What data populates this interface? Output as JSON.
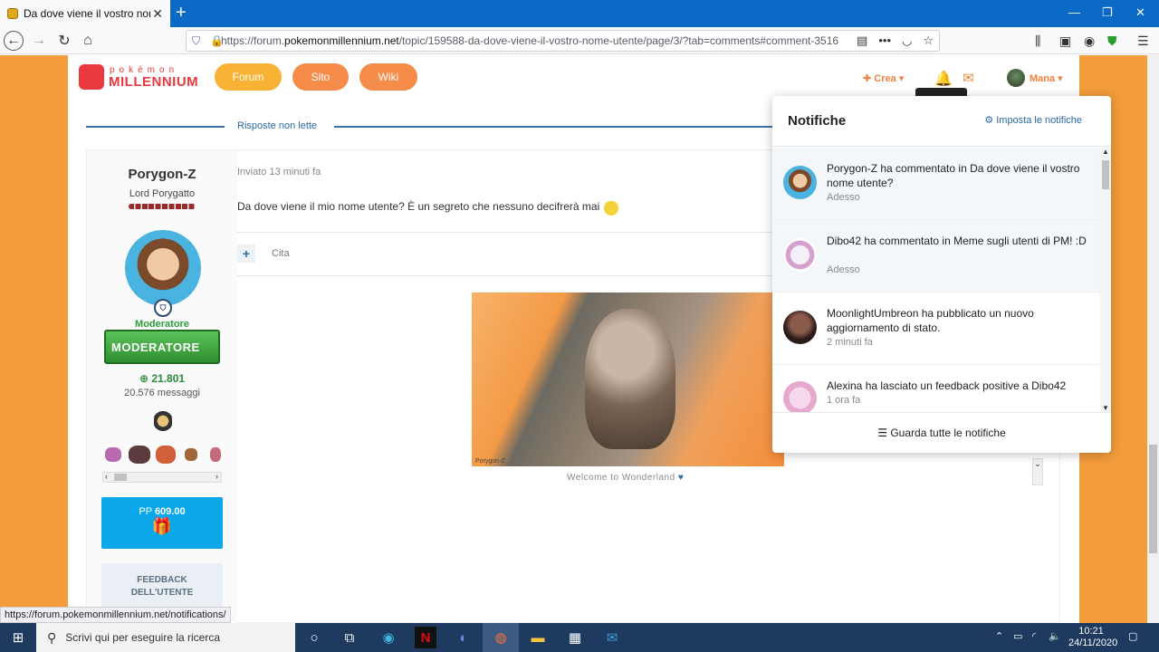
{
  "browser": {
    "tab_title": "Da dove viene il vostro nome u",
    "url_prefix": "https://forum.",
    "url_domain": "pokemonmillennium.net",
    "url_path": "/topic/159588-da-dove-viene-il-vostro-nome-utente/page/3/?tab=comments#comment-3516",
    "status_url": "https://forum.pokemonmillennium.net/notifications/"
  },
  "site": {
    "logo_small": "pokémon",
    "logo_big": "MILLENNIUM",
    "nav": [
      "Forum",
      "Sito",
      "Wiki"
    ],
    "nav_colors": [
      "#f9b233",
      "#f58c4a",
      "#f58c4a"
    ],
    "crea_label": "Crea",
    "user_name": "Mana"
  },
  "thread": {
    "unread_label": "Risposte non lette"
  },
  "post": {
    "author": "Porygon-Z",
    "author_title": "Lord Porygatto",
    "role": "Moderatore",
    "badge_text": "MODERATORE",
    "reputation": "21.801",
    "messages": "20.576 messaggi",
    "pp_label": "PP",
    "pp_value": "609.00",
    "feedback_label_1": "FEEDBACK",
    "feedback_label_2": "DELL'UTENTE",
    "posted": "Inviato 13 minuti fa",
    "text": "Da dove viene il mio nome utente? È un segreto che nessuno decifrerà mai",
    "quote_label": "Cita",
    "signature_caption": "Welcome to Wonderland",
    "signature_watermark": "Porygon-Z"
  },
  "notifications": {
    "title": "Notifiche",
    "settings_label": "Imposta le notifiche",
    "footer_label": "Guarda tutte le notifiche",
    "items": [
      {
        "text": "Porygon-Z ha commentato in Da dove viene il vostro nome utente?",
        "time": "Adesso",
        "unread": true
      },
      {
        "text": "Dibo42 ha commentato in Meme sugli utenti di PM! :D",
        "time": "Adesso",
        "unread": true
      },
      {
        "text": "MoonlightUmbreon ha pubblicato un nuovo aggiornamento di stato.",
        "time": "2 minuti fa",
        "unread": false
      },
      {
        "text": "Alexina ha lasciato un feedback positive a Dibo42",
        "time": "1 ora fa",
        "unread": false
      }
    ]
  },
  "taskbar": {
    "search_placeholder": "Scrivi qui per eseguire la ricerca",
    "time": "10:21",
    "date": "24/11/2020"
  }
}
